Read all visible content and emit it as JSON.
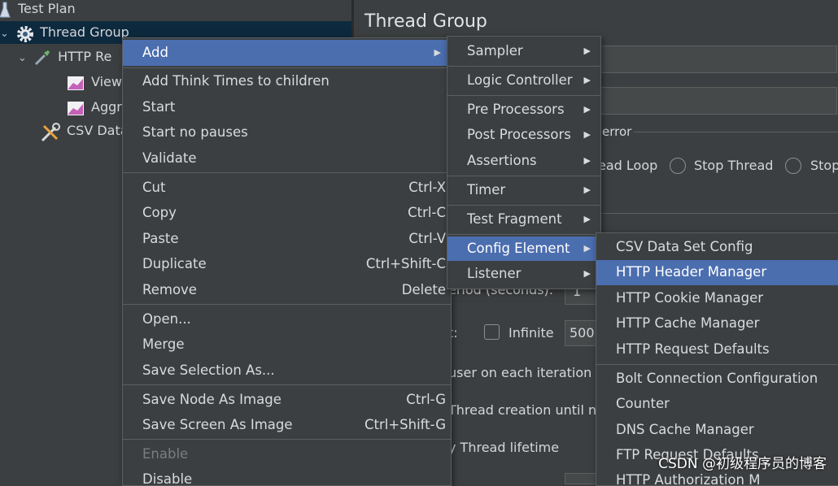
{
  "tree": {
    "items": [
      {
        "label": "Test Plan"
      },
      {
        "label": "Thread Group"
      },
      {
        "label": "HTTP Re"
      },
      {
        "label": "View"
      },
      {
        "label": "Aggr"
      },
      {
        "label": "CSV Data"
      }
    ]
  },
  "panel": {
    "title": "Thread Group",
    "error_label": "error",
    "radio_options": [
      "ead Loop",
      "Stop Thread",
      "Stop"
    ],
    "ramp_label": "eriod (seconds):",
    "ramp_value": "1",
    "loop_label": "t:",
    "infinite_label": "Infinite",
    "loop_value": "500",
    "same_user_label": "user on each iteration",
    "delay_label": "Thread creation until n",
    "lifetime_label": "y Thread lifetime"
  },
  "context_menu": {
    "items": [
      {
        "label": "Add",
        "submenu": true,
        "highlighted": true
      },
      {
        "label": "Add Think Times to children"
      },
      {
        "label": "Start"
      },
      {
        "label": "Start no pauses"
      },
      {
        "label": "Validate"
      },
      {
        "label": "Cut",
        "shortcut": "Ctrl-X"
      },
      {
        "label": "Copy",
        "shortcut": "Ctrl-C"
      },
      {
        "label": "Paste",
        "shortcut": "Ctrl-V"
      },
      {
        "label": "Duplicate",
        "shortcut": "Ctrl+Shift-C"
      },
      {
        "label": "Remove",
        "shortcut": "Delete"
      },
      {
        "label": "Open..."
      },
      {
        "label": "Merge"
      },
      {
        "label": "Save Selection As..."
      },
      {
        "label": "Save Node As Image",
        "shortcut": "Ctrl-G"
      },
      {
        "label": "Save Screen As Image",
        "shortcut": "Ctrl+Shift-G"
      },
      {
        "label": "Enable",
        "disabled": true
      },
      {
        "label": "Disable"
      }
    ]
  },
  "add_submenu": {
    "items": [
      {
        "label": "Sampler"
      },
      {
        "label": "Logic Controller"
      },
      {
        "label": "Pre Processors"
      },
      {
        "label": "Post Processors"
      },
      {
        "label": "Assertions"
      },
      {
        "label": "Timer"
      },
      {
        "label": "Test Fragment"
      },
      {
        "label": "Config Element",
        "highlighted": true
      },
      {
        "label": "Listener"
      }
    ]
  },
  "config_submenu": {
    "items": [
      {
        "label": "CSV Data Set Config"
      },
      {
        "label": "HTTP Header Manager",
        "highlighted": true
      },
      {
        "label": "HTTP Cookie Manager"
      },
      {
        "label": "HTTP Cache Manager"
      },
      {
        "label": "HTTP Request Defaults"
      },
      {
        "label": "Bolt Connection Configuration"
      },
      {
        "label": "Counter"
      },
      {
        "label": "DNS Cache Manager"
      },
      {
        "label": "FTP Request Defaults"
      },
      {
        "label": "HTTP Authorization M"
      }
    ]
  },
  "watermark": "CSDN @初级程序员的博客",
  "colors": {
    "highlight": "#4b6eaf",
    "background": "#3c3f41",
    "selected_row": "#0d293e"
  }
}
